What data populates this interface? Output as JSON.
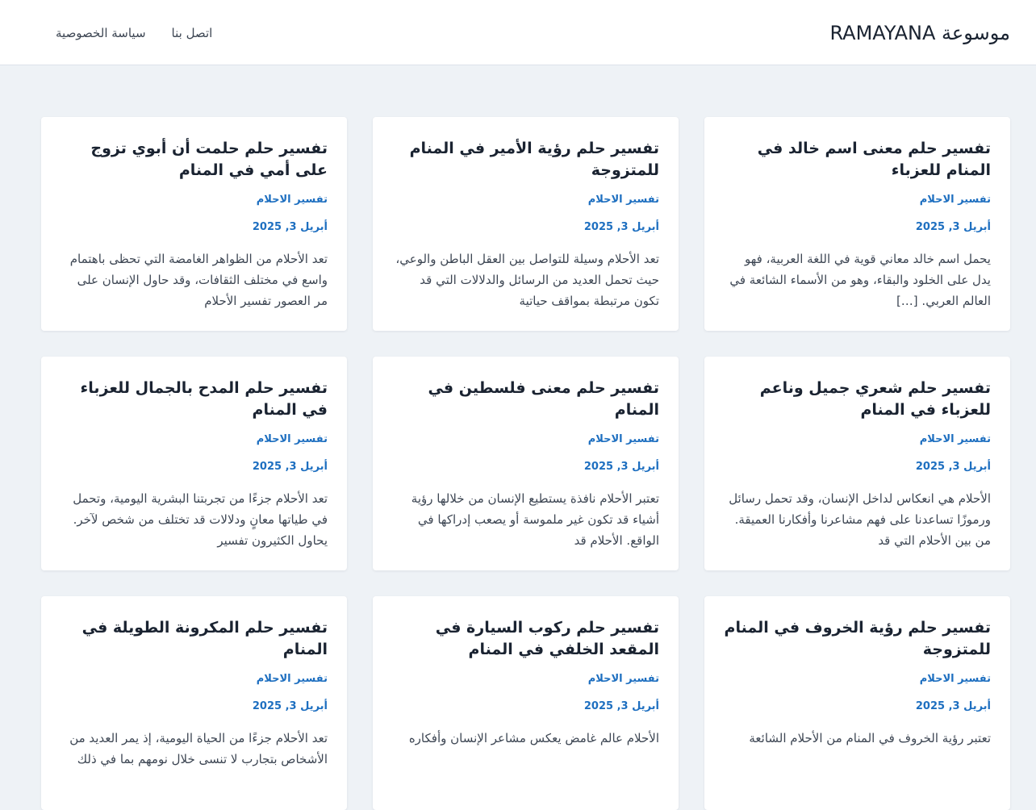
{
  "header": {
    "site_title": "موسوعة RAMAYANA",
    "nav": [
      "سياسة الخصوصية",
      "اتصل بنا"
    ]
  },
  "posts": [
    {
      "title": "تفسير حلم معنى اسم خالد في المنام للعزباء",
      "category": "تفسير الاحلام",
      "date": "أبريل 3, 2025",
      "excerpt": "يحمل اسم خالد معاني قوية في اللغة العربية، فهو يدل على الخلود والبقاء، وهو من الأسماء الشائعة في العالم العربي. […]"
    },
    {
      "title": "تفسير حلم رؤية الأمير في المنام للمتزوجة",
      "category": "تفسير الاحلام",
      "date": "أبريل 3, 2025",
      "excerpt": "تعد الأحلام وسيلة للتواصل بين العقل الباطن والوعي، حيث تحمل العديد من الرسائل والدلالات التي قد تكون مرتبطة بمواقف حياتية"
    },
    {
      "title": "تفسير حلم حلمت أن أبوي تزوج على أمي في المنام",
      "category": "تفسير الاحلام",
      "date": "أبريل 3, 2025",
      "excerpt": "تعد الأحلام من الظواهر الغامضة التي تحظى باهتمام واسع في مختلف الثقافات، وقد حاول الإنسان على مر العصور تفسير الأحلام"
    },
    {
      "title": "تفسير حلم شعري جميل وناعم للعزباء في المنام",
      "category": "تفسير الاحلام",
      "date": "أبريل 3, 2025",
      "excerpt": "الأحلام هي انعكاس لداخل الإنسان، وقد تحمل رسائل ورموزًا تساعدنا على فهم مشاعرنا وأفكارنا العميقة. من بين الأحلام التي قد"
    },
    {
      "title": "تفسير حلم معنى فلسطين في المنام",
      "category": "تفسير الاحلام",
      "date": "أبريل 3, 2025",
      "excerpt": "تعتبر الأحلام نافذة يستطيع الإنسان من خلالها رؤية أشياء قد تكون غير ملموسة أو يصعب إدراكها في الواقع. الأحلام قد"
    },
    {
      "title": "تفسير حلم المدح بالجمال للعزباء في المنام",
      "category": "تفسير الاحلام",
      "date": "أبريل 3, 2025",
      "excerpt": "تعد الأحلام جزءًا من تجربتنا البشرية اليومية، وتحمل في طياتها معانٍ ودلالات قد تختلف من شخص لآخر. يحاول الكثيرون تفسير"
    },
    {
      "title": "تفسير حلم رؤية الخروف في المنام للمتزوجة",
      "category": "تفسير الاحلام",
      "date": "أبريل 3, 2025",
      "excerpt": "تعتبر رؤية الخروف في المنام من الأحلام الشائعة"
    },
    {
      "title": "تفسير حلم ركوب السيارة في المقعد الخلفي في المنام",
      "category": "تفسير الاحلام",
      "date": "أبريل 3, 2025",
      "excerpt": "الأحلام عالم غامض يعكس مشاعر الإنسان وأفكاره"
    },
    {
      "title": "تفسير حلم المكرونة الطويلة في المنام",
      "category": "تفسير الاحلام",
      "date": "أبريل 3, 2025",
      "excerpt": "تعد الأحلام جزءًا من الحياة اليومية، إذ يمر العديد من الأشخاص بتجارب لا تنسى خلال نومهم بما في ذلك"
    }
  ]
}
